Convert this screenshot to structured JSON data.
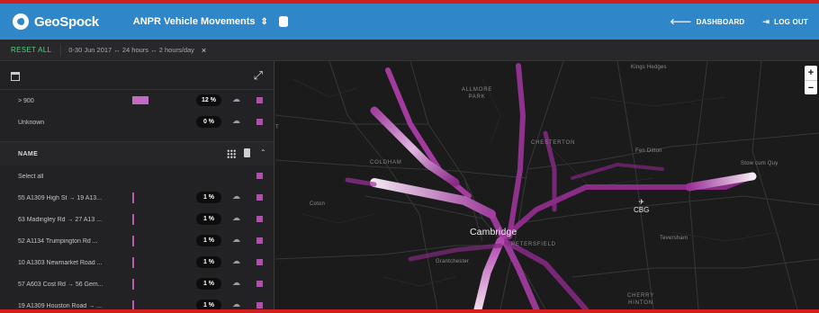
{
  "header": {
    "brand": "GeoSpock",
    "project": "ANPR Vehicle Movements",
    "project_toggle": "⇕",
    "links": [
      {
        "icon": "back-arrow-icon",
        "label": "DASHBOARD"
      },
      {
        "icon": "logout-icon",
        "label": "LOG OUT"
      }
    ]
  },
  "filters": {
    "reset": "RESET ALL",
    "summary": "0-30 Jun 2017  ↔ 24 hours  ↔ 2 hours/day",
    "close": "×"
  },
  "sidebar": {
    "top_rows": [
      {
        "label": "> 900",
        "percent": "12 %"
      },
      {
        "label": "Unknown",
        "percent": "0 %"
      }
    ],
    "name_section": {
      "title": "NAME",
      "select_all": "Select all",
      "rows": [
        {
          "label": "55 A1309 High St → 19 A13...",
          "percent": "1 %"
        },
        {
          "label": "63 Madingley Rd → 27 A13 ...",
          "percent": "1 %"
        },
        {
          "label": "52 A1134 Trumpington Rd ...",
          "percent": "1 %"
        },
        {
          "label": "10 A1303 Newmarket Road ...",
          "percent": "1 %"
        },
        {
          "label": "57 A603 Cost Rd → 56 Gem...",
          "percent": "1 %"
        },
        {
          "label": "19 A1309 Houston Road → ...",
          "percent": "1 %"
        }
      ]
    }
  },
  "map": {
    "labels": {
      "kings_hedges": "Kings Hedges",
      "chimes_park": "ALLMORE PARK",
      "chesterton": "CHESTERTON",
      "coldham": "COLDHAM",
      "fen_ditton": "Fen Ditton",
      "stow_cum_quy": "Stow cum Quy",
      "coton": "Coton",
      "cambridge": "Cambridge",
      "petersfield": "PETERSFIELD",
      "grantchester": "Grantchester",
      "teversham": "Teversham",
      "cherry_hinton": "CHERRY HINTON",
      "cbg_airport_code": "CBG",
      "side_edge": "T"
    },
    "zoom_in": "+",
    "zoom_out": "−",
    "route_color": "#b33bb0"
  }
}
